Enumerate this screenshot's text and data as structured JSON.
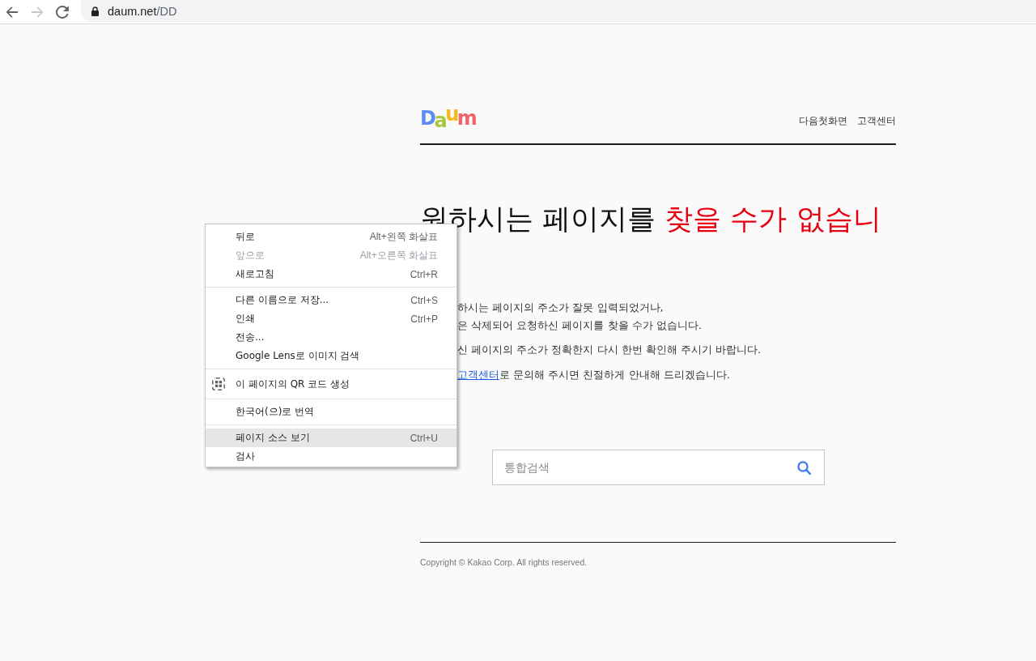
{
  "browser": {
    "toolbar_buttons": [
      {
        "kind": "back",
        "disabled": false
      },
      {
        "kind": "forward",
        "disabled": true
      },
      {
        "kind": "reload",
        "disabled": false
      }
    ],
    "address": {
      "host": "daum.net",
      "path": "/DD"
    }
  },
  "header": {
    "logo": "Daum",
    "links": [
      "다음첫화면",
      "고객센터"
    ]
  },
  "heading": {
    "text": "원하시는 페이지를",
    "emphasis": "찾을 수가 없습니"
  },
  "message": [
    {
      "lines": [
        "하시는 페이지의 주소가 잘못 입력되었거나,",
        "은 삭제되어 요청하신 페이지를 찾을 수가 없습니다."
      ]
    },
    {
      "lines": [
        "신 페이지의 주소가 정확한지 다시 한번 확인해 주시기 바랍니다."
      ]
    },
    {
      "link": "고객센터",
      "lines": [
        "로 문의해 주시면 친절하게 안내해 드리겠습니다."
      ]
    }
  ],
  "search": {
    "placeholder": "통합검색"
  },
  "footer": {
    "copyright": "Copyright © Kakao Corp. All rights reserved."
  },
  "context_menu": {
    "groups": [
      [
        {
          "kind": "command",
          "label": "뒤로",
          "shortcut": "Alt+왼쪽 화살표",
          "disabled": false,
          "selected": false
        },
        {
          "kind": "command",
          "label": "앞으로",
          "shortcut": "Alt+오른쪽 화살표",
          "disabled": true,
          "selected": false
        },
        {
          "kind": "command",
          "label": "새로고침",
          "shortcut": "Ctrl+R",
          "disabled": false,
          "selected": false
        }
      ],
      [
        {
          "kind": "command",
          "label": "다른 이름으로 저장...",
          "shortcut": "Ctrl+S",
          "disabled": false,
          "selected": false
        },
        {
          "kind": "command",
          "label": "인쇄",
          "shortcut": "Ctrl+P",
          "disabled": false,
          "selected": false
        },
        {
          "kind": "command",
          "label": "전송...",
          "disabled": false,
          "selected": false
        },
        {
          "kind": "command",
          "label": "Google Lens로 이미지 검색",
          "disabled": false,
          "selected": false
        }
      ],
      [
        {
          "kind": "qr",
          "label": "이 페이지의 QR 코드 생성",
          "disabled": false,
          "selected": false
        }
      ],
      [
        {
          "kind": "command",
          "label": "한국어(으)로 번역",
          "disabled": false,
          "selected": false
        }
      ],
      [
        {
          "kind": "command",
          "label": "페이지 소스 보기",
          "shortcut": "Ctrl+U",
          "disabled": false,
          "selected": true
        },
        {
          "kind": "command",
          "label": "검사",
          "disabled": false,
          "selected": false
        }
      ]
    ]
  }
}
